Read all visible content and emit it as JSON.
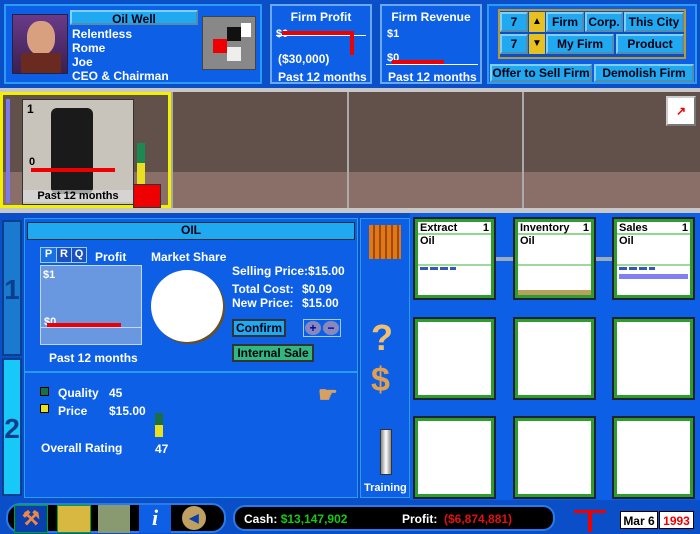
{
  "firm": {
    "name": "Oil Well",
    "lines": [
      "Relentless",
      "Rome",
      "Joe",
      "CEO & Chairman"
    ]
  },
  "profit_box": {
    "title": "Firm Profit",
    "top": "$0",
    "bottom": "($30,000)",
    "period": "Past 12 months"
  },
  "revenue_box": {
    "title": "Firm Revenue",
    "top": "$1",
    "bottom": "$0",
    "period": "Past 12 months"
  },
  "nav": {
    "row1_value": "7",
    "row2_value": "7",
    "firm": "Firm",
    "corp": "Corp.",
    "this_city": "This City",
    "my_firm": "My Firm",
    "product": "Product",
    "offer": "Offer to Sell Firm",
    "demolish": "Demolish Firm"
  },
  "scene": {
    "cell_number": "1",
    "zero": "0",
    "period": "Past 12 months"
  },
  "tabs": [
    "1",
    "2"
  ],
  "product": {
    "title": "OIL",
    "prq": [
      "P",
      "R",
      "Q"
    ],
    "chart_label": "Profit",
    "chart_top": "$1",
    "chart_bottom": "$0",
    "chart_period": "Past 12 months",
    "market_share": "Market Share",
    "selling_price_label": "Selling Price:",
    "selling_price": "$15.00",
    "total_cost_label": "Total Cost:",
    "total_cost": "$0.09",
    "new_price_label": "New Price:",
    "new_price": "$15.00",
    "confirm": "Confirm",
    "internal_sale": "Internal Sale",
    "plus": "+",
    "minus": "−",
    "quality_label": "Quality",
    "quality": "45",
    "price_label": "Price",
    "price": "$15.00",
    "overall_label": "Overall Rating",
    "overall": "47"
  },
  "toolbar": {
    "training": "Training"
  },
  "units": [
    {
      "name": "Extract",
      "level": "1",
      "product": "Oil"
    },
    {
      "name": "Inventory",
      "level": "1",
      "product": "Oil"
    },
    {
      "name": "Sales",
      "level": "1",
      "product": "Oil"
    }
  ],
  "status": {
    "cash_label": "Cash:",
    "cash": "$13,147,902",
    "profit_label": "Profit:",
    "profit": "($6,874,881)",
    "date": "Mar 6",
    "year": "1993"
  },
  "colors": {
    "cash": "#18c818",
    "profit": "#e01010",
    "panel": "#0d5fe6",
    "button": "#20a8f0"
  }
}
